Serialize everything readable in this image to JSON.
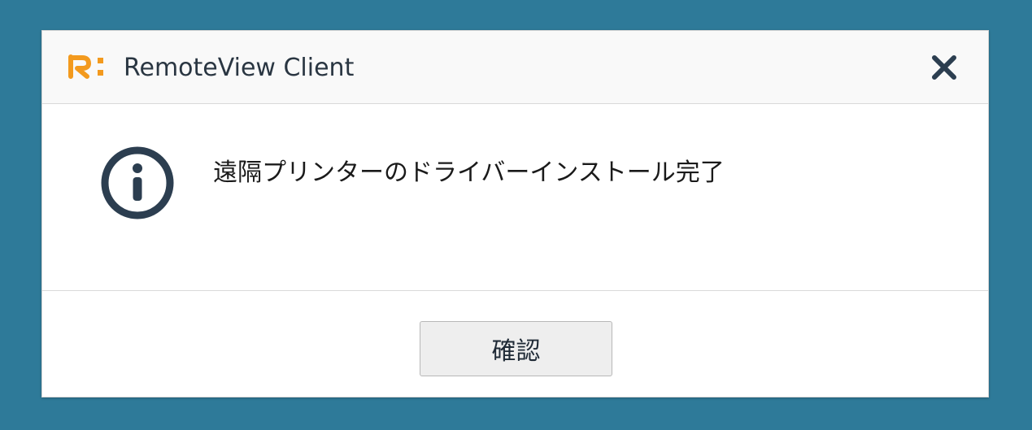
{
  "window": {
    "title": "RemoteView Client",
    "logo_icon": "remoteview-logo-icon",
    "close_icon": "close-icon"
  },
  "message": {
    "icon": "info-icon",
    "text": "遠隔プリンターのドライバーインストール完了"
  },
  "footer": {
    "confirm_label": "確認"
  },
  "colors": {
    "background": "#2e7a99",
    "logo": "#f39a1e",
    "icon_dark": "#2c3e50"
  }
}
